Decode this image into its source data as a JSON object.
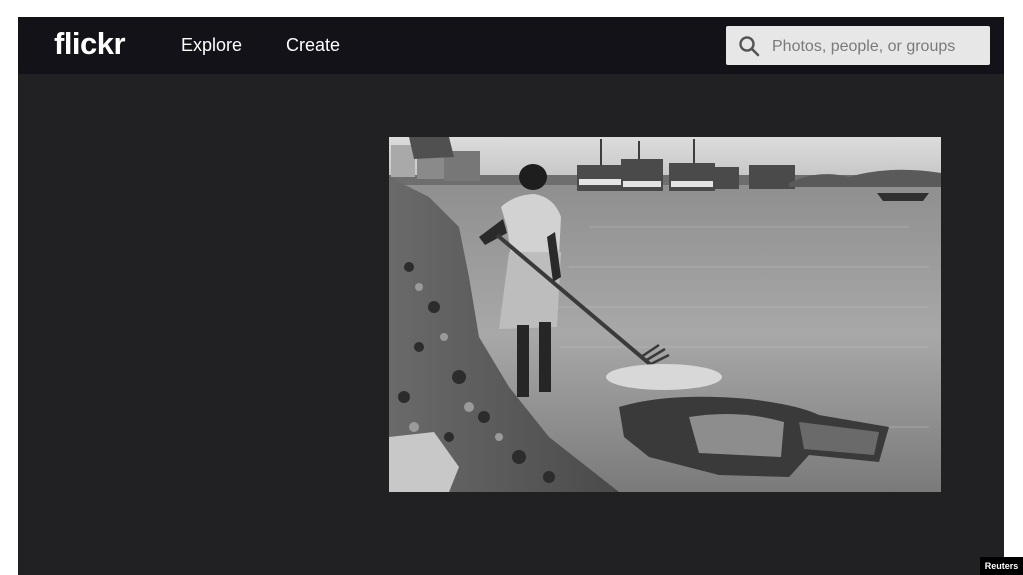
{
  "header": {
    "logo_text": "flickr",
    "nav": [
      {
        "label": "Explore"
      },
      {
        "label": "Create"
      }
    ],
    "search": {
      "placeholder": "Photos, people, or groups",
      "icon": "search-icon"
    }
  },
  "photo": {
    "kind": "black-and-white photograph"
  },
  "credit": {
    "text": "Reuters"
  },
  "colors": {
    "topbar": "#121218",
    "page_background": "#212124",
    "search_field": "#e7e7e7",
    "nav_text": "#ffffff"
  }
}
